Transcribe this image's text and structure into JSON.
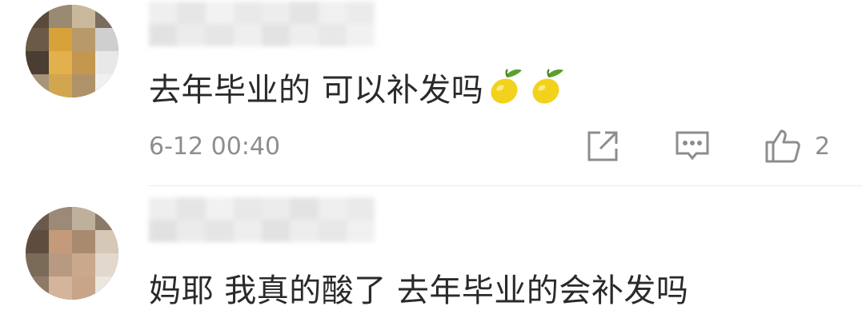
{
  "comments": [
    {
      "text": "去年毕业的 可以补发吗",
      "emoji_icons": [
        "lemon-icon",
        "lemon-icon"
      ],
      "time": "6-12 00:40",
      "likes": "2",
      "colors": {
        "avatar_blocks": [
          "#5a4a3a",
          "#9a8a72",
          "#c9b89b",
          "#7a6d5e",
          "#6b5a46",
          "#d8a23a",
          "#b89a6a",
          "#cfcfcf",
          "#4a3e32",
          "#e3b04e",
          "#c49750",
          "#e8e8e8",
          "#a89478",
          "#d2a64e",
          "#b0926a",
          "#f0f0f0"
        ]
      }
    },
    {
      "text": "妈耶 我真的酸了 去年毕业的会补发吗",
      "colors": {
        "avatar_blocks": [
          "#6a5a4c",
          "#9c8a76",
          "#bfb09c",
          "#8a7a68",
          "#5e4c3e",
          "#c49a7a",
          "#a88a70",
          "#d6c8b6",
          "#7a6a58",
          "#b89a82",
          "#caa88c",
          "#e2d8cc",
          "#8e7a66",
          "#d4b49a",
          "#c8a488",
          "#ede6de"
        ]
      }
    }
  ],
  "icons": {
    "share": "share-icon",
    "reply": "comment-icon",
    "like": "thumbs-up-icon"
  }
}
